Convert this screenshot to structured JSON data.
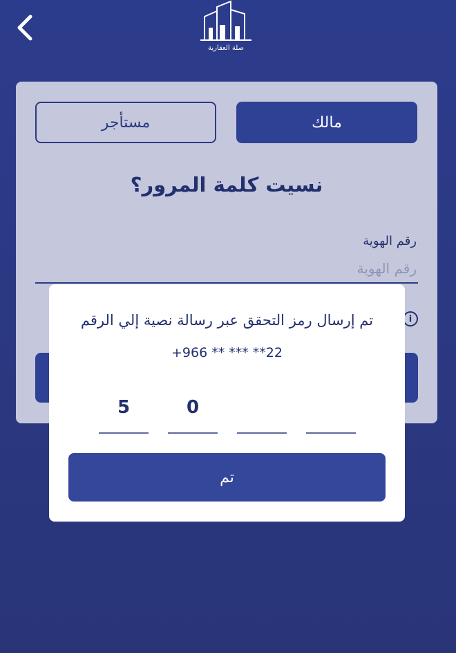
{
  "header": {
    "back_icon": "chevron-left-icon",
    "logo_text": "صلة العقارية"
  },
  "tabs": {
    "owner": "مالك",
    "tenant": "مستأجر"
  },
  "form": {
    "title": "نسيت كلمة المرور؟",
    "id_label": "رقم الهوية",
    "id_placeholder": "رقم الهوية",
    "info_icon": "info-icon"
  },
  "modal": {
    "message": "تم إرسال رمز التحقق عبر رسالة نصية إلي الرقم",
    "phone": "+966 ** *** **22",
    "otp": [
      "5",
      "0",
      "",
      ""
    ],
    "done_label": "تم"
  },
  "colors": {
    "background": "#2c3c8c",
    "primary": "#2f4195",
    "card": "#c5c8dc",
    "text": "#22306e"
  }
}
